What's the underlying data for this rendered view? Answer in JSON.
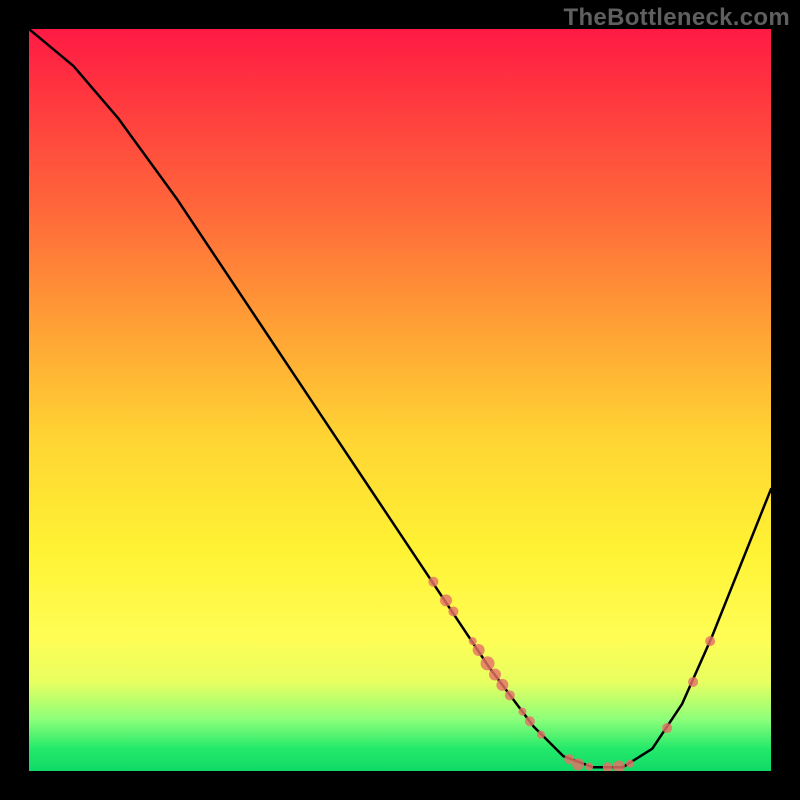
{
  "watermark": "TheBottleneck.com",
  "chart_data": {
    "type": "line",
    "title": "",
    "xlabel": "",
    "ylabel": "",
    "xlim": [
      0,
      100
    ],
    "ylim": [
      0,
      100
    ],
    "curve": [
      {
        "x": 0,
        "y": 100
      },
      {
        "x": 6,
        "y": 95
      },
      {
        "x": 12,
        "y": 88
      },
      {
        "x": 20,
        "y": 77
      },
      {
        "x": 30,
        "y": 62
      },
      {
        "x": 40,
        "y": 47
      },
      {
        "x": 50,
        "y": 32
      },
      {
        "x": 56,
        "y": 23
      },
      {
        "x": 62,
        "y": 14
      },
      {
        "x": 68,
        "y": 6
      },
      {
        "x": 72,
        "y": 2
      },
      {
        "x": 76,
        "y": 0.5
      },
      {
        "x": 80,
        "y": 0.5
      },
      {
        "x": 84,
        "y": 3
      },
      {
        "x": 88,
        "y": 9
      },
      {
        "x": 92,
        "y": 18
      },
      {
        "x": 96,
        "y": 28
      },
      {
        "x": 100,
        "y": 38
      }
    ],
    "markers": [
      {
        "x": 54.5,
        "y": 25.5,
        "r": 5
      },
      {
        "x": 56.2,
        "y": 23.0,
        "r": 6
      },
      {
        "x": 57.2,
        "y": 21.5,
        "r": 5
      },
      {
        "x": 59.8,
        "y": 17.5,
        "r": 4
      },
      {
        "x": 60.6,
        "y": 16.3,
        "r": 6
      },
      {
        "x": 61.8,
        "y": 14.5,
        "r": 7
      },
      {
        "x": 62.8,
        "y": 13.0,
        "r": 6
      },
      {
        "x": 63.8,
        "y": 11.6,
        "r": 6
      },
      {
        "x": 64.8,
        "y": 10.2,
        "r": 5
      },
      {
        "x": 66.5,
        "y": 8.0,
        "r": 4
      },
      {
        "x": 67.5,
        "y": 6.7,
        "r": 5
      },
      {
        "x": 69.0,
        "y": 4.9,
        "r": 4
      },
      {
        "x": 72.8,
        "y": 1.6,
        "r": 5
      },
      {
        "x": 74.0,
        "y": 0.9,
        "r": 6
      },
      {
        "x": 75.5,
        "y": 0.6,
        "r": 4
      },
      {
        "x": 78.0,
        "y": 0.5,
        "r": 5
      },
      {
        "x": 79.5,
        "y": 0.6,
        "r": 6
      },
      {
        "x": 81.0,
        "y": 1.0,
        "r": 4
      },
      {
        "x": 86.0,
        "y": 5.8,
        "r": 5
      },
      {
        "x": 89.5,
        "y": 12.0,
        "r": 5
      },
      {
        "x": 91.8,
        "y": 17.5,
        "r": 5
      }
    ],
    "colors": {
      "curve": "#000000",
      "marker_fill": "#e57367",
      "marker_stroke": "#e57367"
    }
  }
}
